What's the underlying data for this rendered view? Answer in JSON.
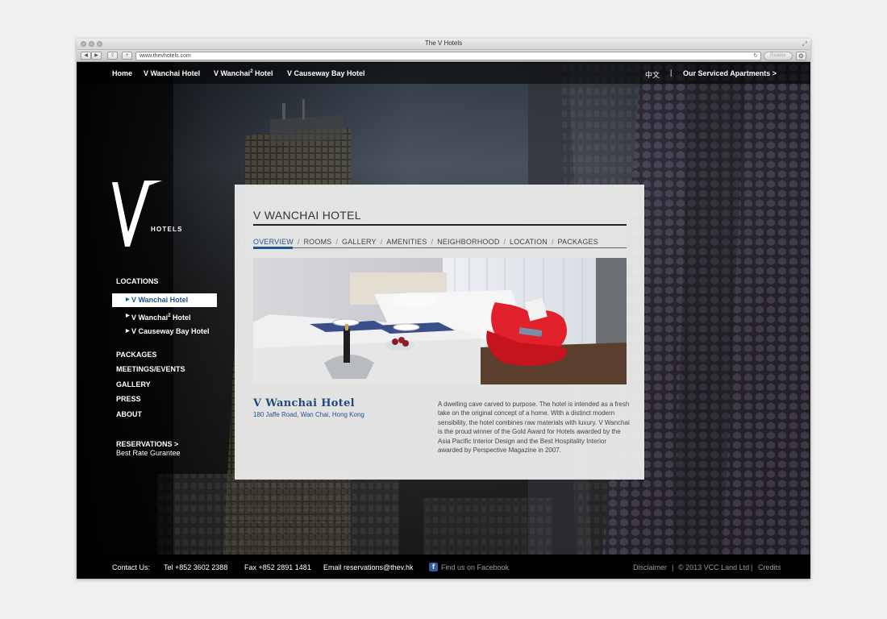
{
  "browser": {
    "title": "The V Hotels",
    "url": "www.thevhotels.com",
    "reader_label": "Reader"
  },
  "topnav": {
    "home": "Home",
    "wanchai": "V Wanchai Hotel",
    "wanchai2": "V Wanchai",
    "wanchai2_sup": "2",
    "wanchai2_suffix": " Hotel",
    "causeway": "V Causeway Bay Hotel",
    "lang": "中文",
    "separator": "|",
    "serviced": "Our Serviced Apartments >"
  },
  "logo": {
    "letter": "V",
    "text": "HOTELS"
  },
  "sidebar": {
    "locations_label": "LOCATIONS",
    "sub_items": [
      {
        "label": "V Wanchai Hotel"
      },
      {
        "label": "V Wanchai",
        "sup": "2",
        "suffix": " Hotel"
      },
      {
        "label": "V Causeway Bay Hotel"
      }
    ],
    "packages": "PACKAGES",
    "meetings": "MEETINGS/EVENTS",
    "gallery": "GALLERY",
    "press": "PRESS",
    "about": "ABOUT",
    "reservations": "RESERVATIONS >",
    "best_rate": "Best Rate Gurantee"
  },
  "panel": {
    "title": "V WANCHAI HOTEL",
    "tabs": [
      "OVERVIEW",
      "ROOMS",
      "GALLERY",
      "AMENITIES",
      "NEIGHBORHOOD",
      "LOCATION",
      "PACKAGES"
    ],
    "tab_sep": "/",
    "hotel_name": "V Wanchai Hotel",
    "address": "180 Jaffe Road, Wan Chai, Hong Kong",
    "description": "A dwelling cave carved to purpose. The hotel is intended as a fresh take on the original concept of a home. With a distinct modern sensibility, the hotel combines raw materials with luxury. V Wanchai is the proud winner of the Gold Award for Hotels awarded by the Asia Pacific Interior Design and the Best Hospitality Interior awarded by Perspective Magazine in 2007."
  },
  "footer": {
    "contact": "Contact Us:",
    "tel": "Tel +852 3602 2388",
    "fax": "Fax +852 2891 1481",
    "email": "Email reservations@thev.hk",
    "facebook": "Find us on Facebook",
    "disclaimer": "Disclaimer",
    "sep": "|",
    "copyright": "© 2013 VCC Land Ltd",
    "credits": "Credits"
  },
  "colors": {
    "accent": "#1f5290",
    "panel_bg": "#eeeeee",
    "nav_text": "#ffffff"
  }
}
